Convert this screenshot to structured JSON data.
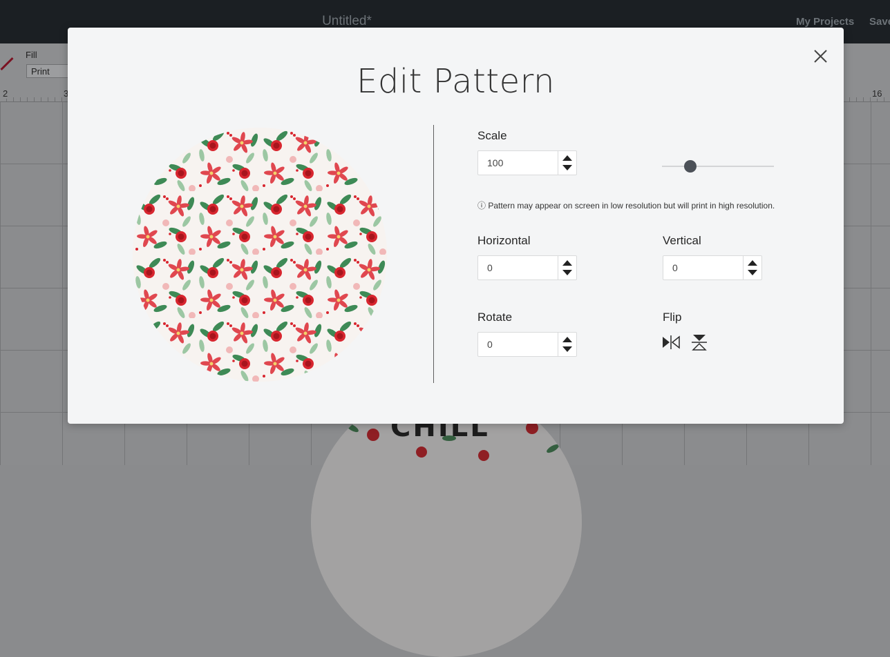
{
  "app": {
    "document_title": "Untitled*",
    "my_projects_label": "My Projects",
    "save_label": "Save"
  },
  "toolbar": {
    "fill_label": "Fill",
    "fill_value": "Print"
  },
  "ruler": {
    "left_numbers": [
      "2",
      "3"
    ],
    "right_number": "16"
  },
  "canvas": {
    "design_text": "CHILL"
  },
  "modal": {
    "title": "Edit Pattern",
    "scale": {
      "label": "Scale",
      "value": "100",
      "slider_fraction": 0.25
    },
    "note": "ⓘ Pattern may appear on screen in low resolution but will print in high resolution.",
    "horizontal": {
      "label": "Horizontal",
      "value": "0"
    },
    "vertical": {
      "label": "Vertical",
      "value": "0"
    },
    "rotate": {
      "label": "Rotate",
      "value": "0"
    },
    "flip": {
      "label": "Flip"
    }
  },
  "colors": {
    "modal_bg": "#f4f5f6",
    "topbar_bg": "#1b1f23",
    "slider_thumb": "#4c5158",
    "flower_red": "#d8262f",
    "leaf_green": "#3e8a56"
  },
  "icons": [
    "close-icon",
    "chevron-up-icon",
    "chevron-down-icon",
    "flip-horizontal-icon",
    "flip-vertical-icon"
  ]
}
